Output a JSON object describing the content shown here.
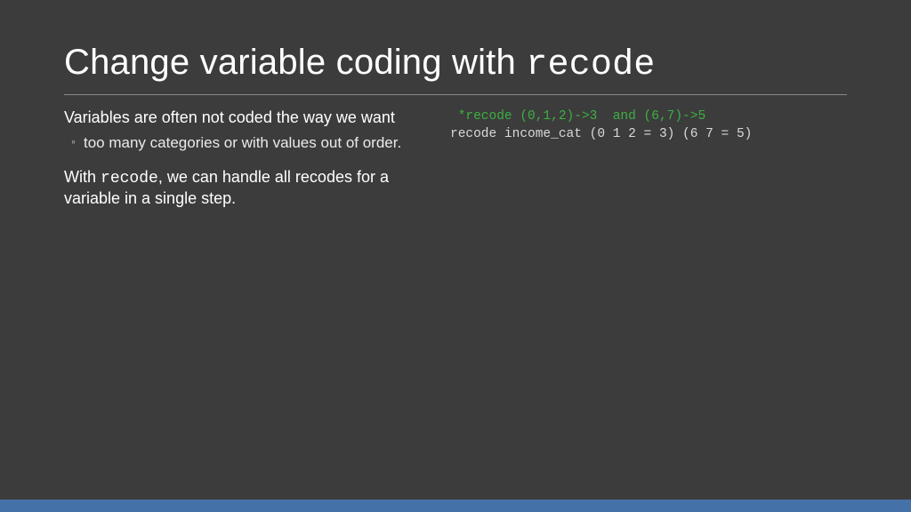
{
  "title": {
    "prefix": "Change variable coding with ",
    "mono": "recode"
  },
  "left": {
    "p1": "Variables are often not coded the way we want",
    "sub1": "too many categories or with values out of order.",
    "p2a": "With ",
    "p2mono": "recode",
    "p2b": ", we can handle all recodes for a variable in a single step."
  },
  "code": {
    "comment": " *recode (0,1,2)->3  and (6,7)->5",
    "stmt": "recode income_cat (0 1 2 = 3) (6 7 = 5)"
  }
}
